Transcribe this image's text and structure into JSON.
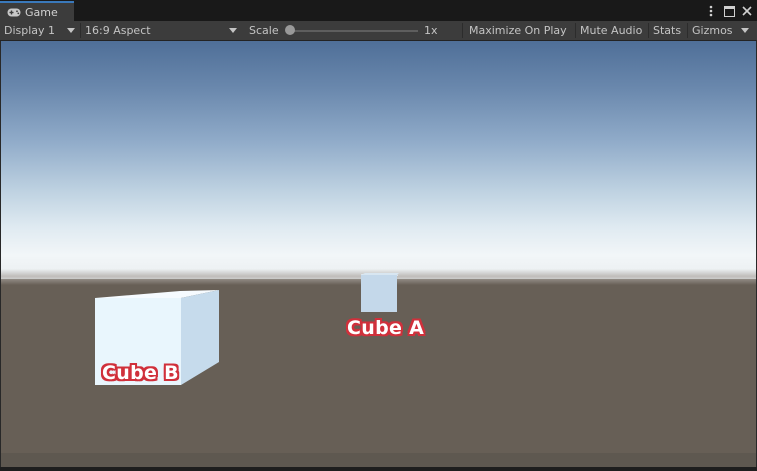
{
  "window": {
    "tab_title": "Game",
    "tab_icon": "gamepad-icon",
    "actions": {
      "more_icon": "kebab-menu-icon",
      "maximize_icon": "maximize-icon",
      "close_icon": "close-icon"
    }
  },
  "toolbar": {
    "display_label": "Display 1",
    "aspect_label": "16:9 Aspect",
    "scale_label": "Scale",
    "scale_value": "1x",
    "scale_level": 0.0,
    "maximize_on_play": "Maximize On Play",
    "mute_audio": "Mute Audio",
    "stats": "Stats",
    "gizmos": "Gizmos"
  },
  "scene": {
    "cube_a_label": "Cube A",
    "cube_b_label": "Cube B",
    "label_outline_color": "#d0303b",
    "sky_top_color": "#4f6f98",
    "horizon_color": "#f2f6f8",
    "ground_color": "#675f56"
  }
}
